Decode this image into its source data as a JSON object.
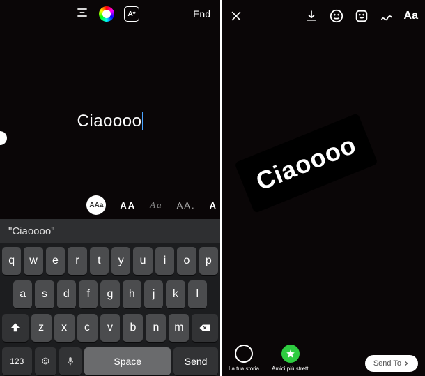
{
  "left": {
    "toolbar": {
      "end_label": "End"
    },
    "typed_text": "Ciaoooo",
    "font_styles": {
      "selected_label": "AAa",
      "opt2": "AA",
      "opt3": "Aa",
      "opt4": "AA.",
      "opt5": "A"
    },
    "suggestion": "\"Ciaoooo\"",
    "keyboard": {
      "row1": [
        "q",
        "w",
        "e",
        "r",
        "t",
        "y",
        "u",
        "i",
        "o",
        "p"
      ],
      "row2": [
        "a",
        "s",
        "d",
        "f",
        "g",
        "h",
        "j",
        "k",
        "l"
      ],
      "row3": [
        "z",
        "x",
        "c",
        "v",
        "b",
        "n",
        "m"
      ],
      "sym_key": "123",
      "space_key": "Space",
      "send_key": "Send"
    }
  },
  "right": {
    "toolbar": {
      "aa_label": "Aa"
    },
    "sticker_text": "Ciaoooo",
    "bottom": {
      "your_story": "La tua storia",
      "close_friends": "Amici più stretti",
      "send_to": "Send To"
    }
  }
}
